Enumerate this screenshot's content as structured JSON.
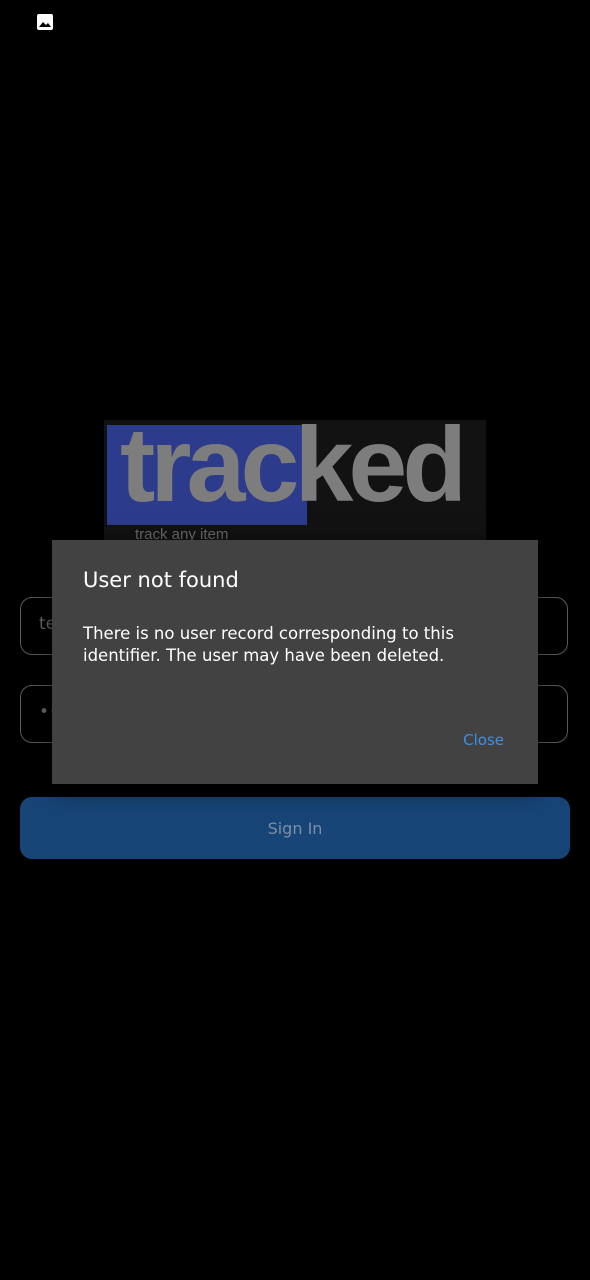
{
  "status_bar": {
    "icon": "image-icon"
  },
  "logo": {
    "word": "tracked",
    "tagline": "track any item"
  },
  "form": {
    "email_value": "te",
    "password_value": "•••",
    "signin_label": "Sign In"
  },
  "dialog": {
    "title": "User not found",
    "message": "There is no user record corresponding to this identifier. The user may have been deleted.",
    "close_label": "Close"
  },
  "colors": {
    "background": "#000000",
    "dialog_bg": "#424242",
    "accent": "#3c8fe6",
    "button": "#174578",
    "logo_highlight": "#2c3b8c"
  }
}
